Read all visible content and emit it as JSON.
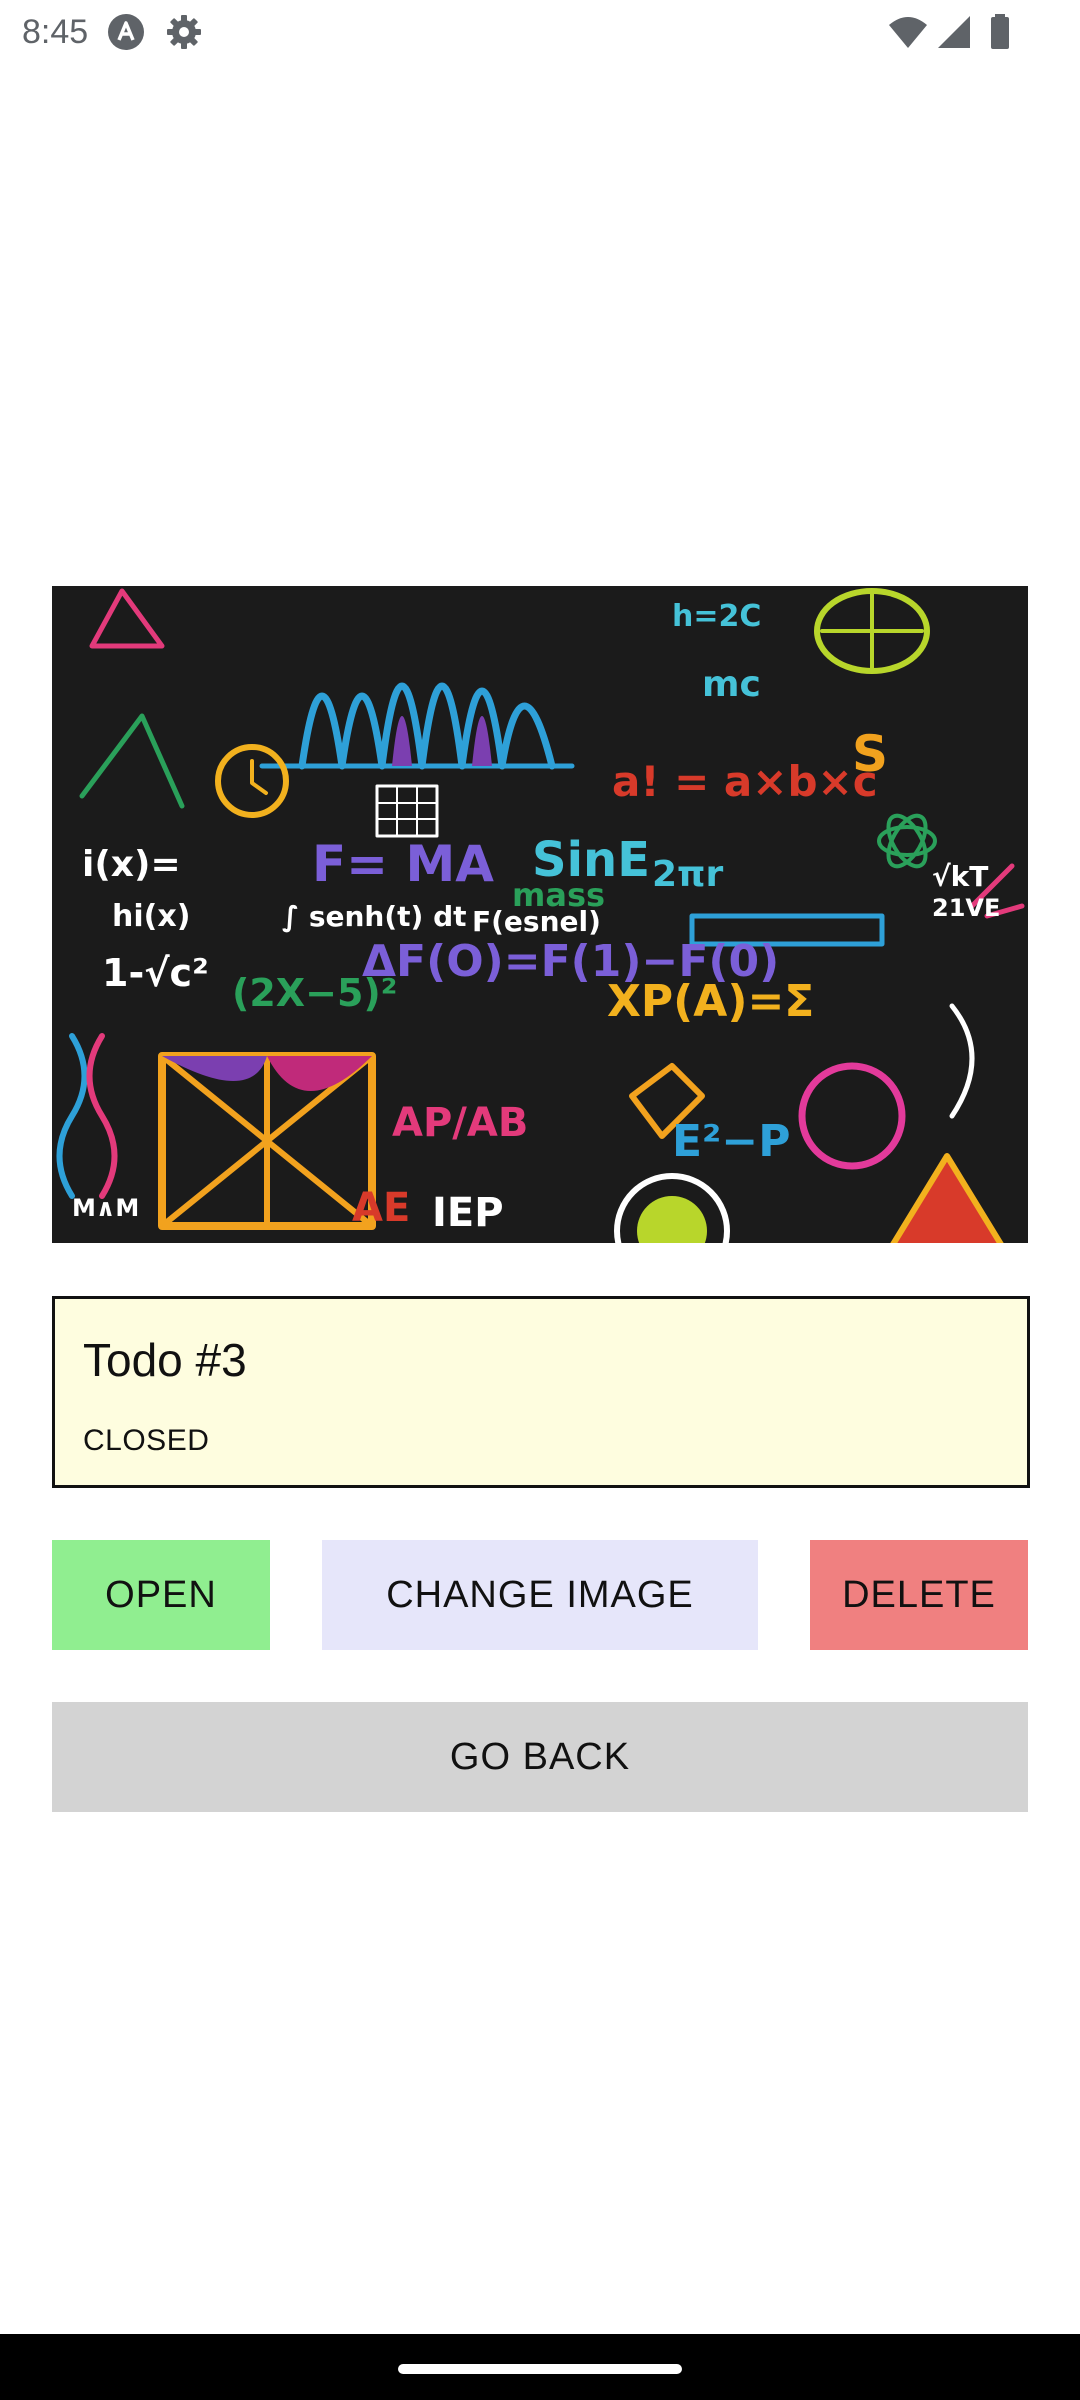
{
  "status_bar": {
    "time": "8:45",
    "left_icons": [
      "app-notification-icon",
      "settings-gear-icon"
    ],
    "right_icons": [
      "wifi-icon",
      "cellular-signal-icon",
      "battery-icon"
    ]
  },
  "hero_image": {
    "description_icon": "math-chalkboard-image",
    "background_color": "#1b1b1b"
  },
  "todo": {
    "title": "Todo #3",
    "status": "CLOSED",
    "card_background": "#fefddf"
  },
  "actions": {
    "open_label": "OPEN",
    "change_image_label": "CHANGE IMAGE",
    "delete_label": "DELETE",
    "go_back_label": "GO BACK",
    "colors": {
      "open": "#90ee90",
      "change_image": "#e6e6fa",
      "delete": "#f08080",
      "go_back": "#d3d3d3"
    }
  }
}
